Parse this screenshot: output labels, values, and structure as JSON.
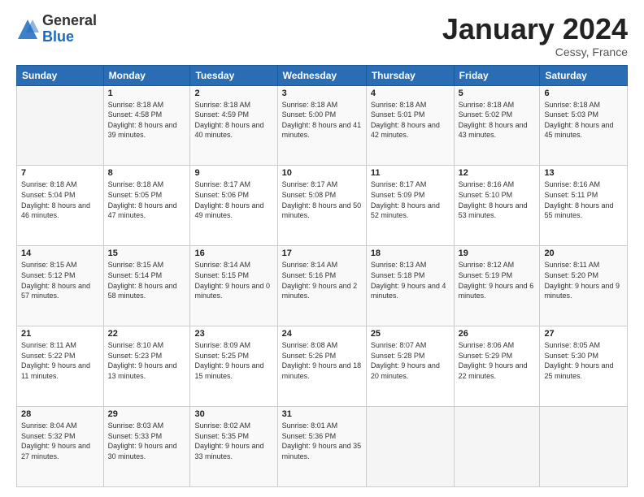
{
  "logo": {
    "general": "General",
    "blue": "Blue"
  },
  "title": "January 2024",
  "location": "Cessy, France",
  "days_header": [
    "Sunday",
    "Monday",
    "Tuesday",
    "Wednesday",
    "Thursday",
    "Friday",
    "Saturday"
  ],
  "weeks": [
    [
      {
        "day": "",
        "sunrise": "",
        "sunset": "",
        "daylight": ""
      },
      {
        "day": "1",
        "sunrise": "Sunrise: 8:18 AM",
        "sunset": "Sunset: 4:58 PM",
        "daylight": "Daylight: 8 hours and 39 minutes."
      },
      {
        "day": "2",
        "sunrise": "Sunrise: 8:18 AM",
        "sunset": "Sunset: 4:59 PM",
        "daylight": "Daylight: 8 hours and 40 minutes."
      },
      {
        "day": "3",
        "sunrise": "Sunrise: 8:18 AM",
        "sunset": "Sunset: 5:00 PM",
        "daylight": "Daylight: 8 hours and 41 minutes."
      },
      {
        "day": "4",
        "sunrise": "Sunrise: 8:18 AM",
        "sunset": "Sunset: 5:01 PM",
        "daylight": "Daylight: 8 hours and 42 minutes."
      },
      {
        "day": "5",
        "sunrise": "Sunrise: 8:18 AM",
        "sunset": "Sunset: 5:02 PM",
        "daylight": "Daylight: 8 hours and 43 minutes."
      },
      {
        "day": "6",
        "sunrise": "Sunrise: 8:18 AM",
        "sunset": "Sunset: 5:03 PM",
        "daylight": "Daylight: 8 hours and 45 minutes."
      }
    ],
    [
      {
        "day": "7",
        "sunrise": "Sunrise: 8:18 AM",
        "sunset": "Sunset: 5:04 PM",
        "daylight": "Daylight: 8 hours and 46 minutes."
      },
      {
        "day": "8",
        "sunrise": "Sunrise: 8:18 AM",
        "sunset": "Sunset: 5:05 PM",
        "daylight": "Daylight: 8 hours and 47 minutes."
      },
      {
        "day": "9",
        "sunrise": "Sunrise: 8:17 AM",
        "sunset": "Sunset: 5:06 PM",
        "daylight": "Daylight: 8 hours and 49 minutes."
      },
      {
        "day": "10",
        "sunrise": "Sunrise: 8:17 AM",
        "sunset": "Sunset: 5:08 PM",
        "daylight": "Daylight: 8 hours and 50 minutes."
      },
      {
        "day": "11",
        "sunrise": "Sunrise: 8:17 AM",
        "sunset": "Sunset: 5:09 PM",
        "daylight": "Daylight: 8 hours and 52 minutes."
      },
      {
        "day": "12",
        "sunrise": "Sunrise: 8:16 AM",
        "sunset": "Sunset: 5:10 PM",
        "daylight": "Daylight: 8 hours and 53 minutes."
      },
      {
        "day": "13",
        "sunrise": "Sunrise: 8:16 AM",
        "sunset": "Sunset: 5:11 PM",
        "daylight": "Daylight: 8 hours and 55 minutes."
      }
    ],
    [
      {
        "day": "14",
        "sunrise": "Sunrise: 8:15 AM",
        "sunset": "Sunset: 5:12 PM",
        "daylight": "Daylight: 8 hours and 57 minutes."
      },
      {
        "day": "15",
        "sunrise": "Sunrise: 8:15 AM",
        "sunset": "Sunset: 5:14 PM",
        "daylight": "Daylight: 8 hours and 58 minutes."
      },
      {
        "day": "16",
        "sunrise": "Sunrise: 8:14 AM",
        "sunset": "Sunset: 5:15 PM",
        "daylight": "Daylight: 9 hours and 0 minutes."
      },
      {
        "day": "17",
        "sunrise": "Sunrise: 8:14 AM",
        "sunset": "Sunset: 5:16 PM",
        "daylight": "Daylight: 9 hours and 2 minutes."
      },
      {
        "day": "18",
        "sunrise": "Sunrise: 8:13 AM",
        "sunset": "Sunset: 5:18 PM",
        "daylight": "Daylight: 9 hours and 4 minutes."
      },
      {
        "day": "19",
        "sunrise": "Sunrise: 8:12 AM",
        "sunset": "Sunset: 5:19 PM",
        "daylight": "Daylight: 9 hours and 6 minutes."
      },
      {
        "day": "20",
        "sunrise": "Sunrise: 8:11 AM",
        "sunset": "Sunset: 5:20 PM",
        "daylight": "Daylight: 9 hours and 9 minutes."
      }
    ],
    [
      {
        "day": "21",
        "sunrise": "Sunrise: 8:11 AM",
        "sunset": "Sunset: 5:22 PM",
        "daylight": "Daylight: 9 hours and 11 minutes."
      },
      {
        "day": "22",
        "sunrise": "Sunrise: 8:10 AM",
        "sunset": "Sunset: 5:23 PM",
        "daylight": "Daylight: 9 hours and 13 minutes."
      },
      {
        "day": "23",
        "sunrise": "Sunrise: 8:09 AM",
        "sunset": "Sunset: 5:25 PM",
        "daylight": "Daylight: 9 hours and 15 minutes."
      },
      {
        "day": "24",
        "sunrise": "Sunrise: 8:08 AM",
        "sunset": "Sunset: 5:26 PM",
        "daylight": "Daylight: 9 hours and 18 minutes."
      },
      {
        "day": "25",
        "sunrise": "Sunrise: 8:07 AM",
        "sunset": "Sunset: 5:28 PM",
        "daylight": "Daylight: 9 hours and 20 minutes."
      },
      {
        "day": "26",
        "sunrise": "Sunrise: 8:06 AM",
        "sunset": "Sunset: 5:29 PM",
        "daylight": "Daylight: 9 hours and 22 minutes."
      },
      {
        "day": "27",
        "sunrise": "Sunrise: 8:05 AM",
        "sunset": "Sunset: 5:30 PM",
        "daylight": "Daylight: 9 hours and 25 minutes."
      }
    ],
    [
      {
        "day": "28",
        "sunrise": "Sunrise: 8:04 AM",
        "sunset": "Sunset: 5:32 PM",
        "daylight": "Daylight: 9 hours and 27 minutes."
      },
      {
        "day": "29",
        "sunrise": "Sunrise: 8:03 AM",
        "sunset": "Sunset: 5:33 PM",
        "daylight": "Daylight: 9 hours and 30 minutes."
      },
      {
        "day": "30",
        "sunrise": "Sunrise: 8:02 AM",
        "sunset": "Sunset: 5:35 PM",
        "daylight": "Daylight: 9 hours and 33 minutes."
      },
      {
        "day": "31",
        "sunrise": "Sunrise: 8:01 AM",
        "sunset": "Sunset: 5:36 PM",
        "daylight": "Daylight: 9 hours and 35 minutes."
      },
      {
        "day": "",
        "sunrise": "",
        "sunset": "",
        "daylight": ""
      },
      {
        "day": "",
        "sunrise": "",
        "sunset": "",
        "daylight": ""
      },
      {
        "day": "",
        "sunrise": "",
        "sunset": "",
        "daylight": ""
      }
    ]
  ]
}
